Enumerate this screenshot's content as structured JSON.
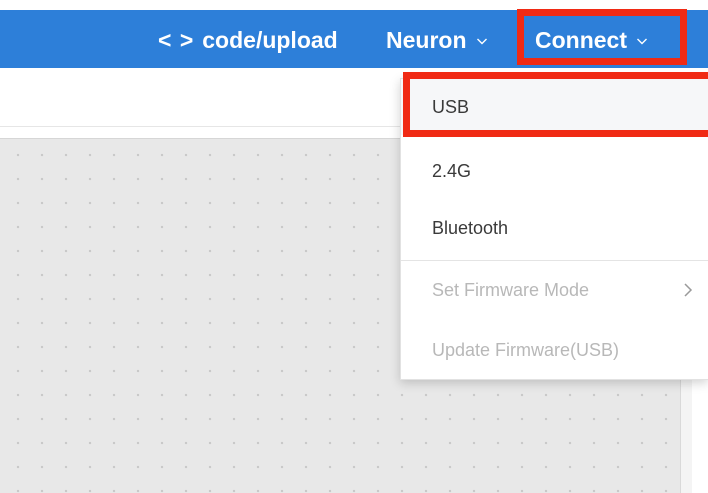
{
  "topbar": {
    "code_glyph": "< >",
    "code_upload": "code/upload",
    "neuron": "Neuron",
    "connect": "Connect"
  },
  "connect_menu": {
    "items": [
      {
        "label": "USB",
        "enabled": true
      },
      {
        "label": "2.4G",
        "enabled": true
      },
      {
        "label": "Bluetooth",
        "enabled": true
      },
      {
        "label": "Set Firmware Mode",
        "enabled": false,
        "has_submenu": true
      },
      {
        "label": "Update Firmware(USB)",
        "enabled": false
      }
    ]
  },
  "colors": {
    "topbar": "#2d7fd9",
    "highlight": "#f02a14",
    "canvas": "#e8e8e8",
    "menu_text": "#3a3a3a",
    "menu_text_disabled": "#b8b8b8"
  },
  "icons": {
    "dropdown": "chevron-down-icon",
    "submenu": "chevron-right-icon",
    "code": "code-brackets-icon"
  }
}
